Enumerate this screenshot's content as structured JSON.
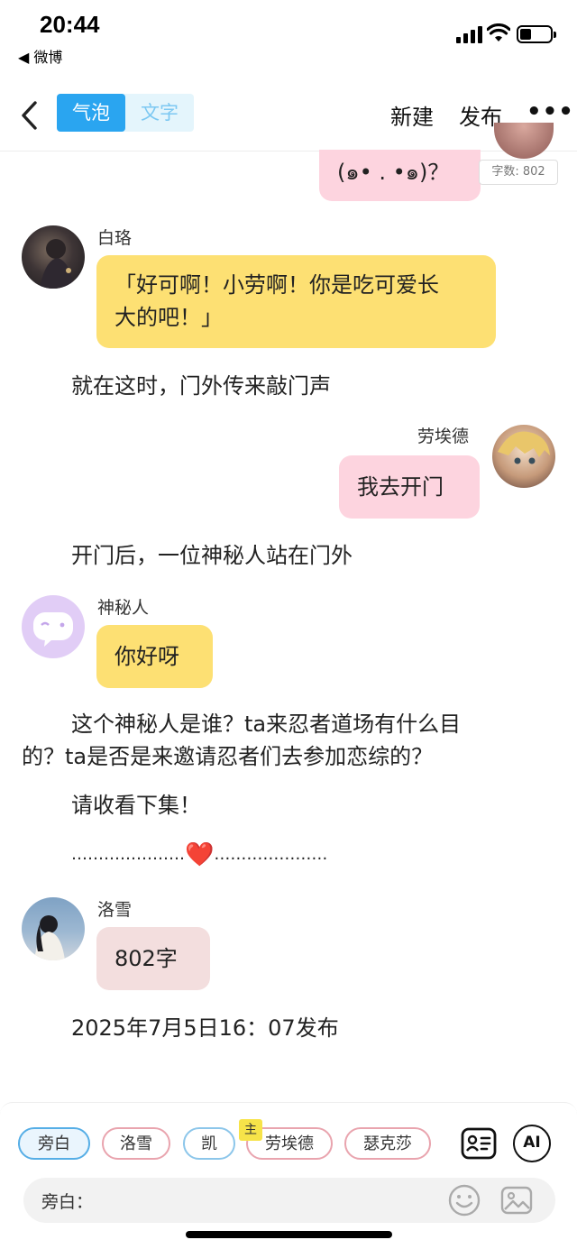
{
  "status": {
    "time": "20:44",
    "back_app": "◀ 微博"
  },
  "nav": {
    "seg_bubble": "气泡",
    "seg_text": "文字",
    "new_label": "新建",
    "publish_label": "发布",
    "more_label": "•••"
  },
  "chat": {
    "partial_bubble": "(๑• . •๑)？",
    "word_count_badge": "字数: 802",
    "msg1_name": "白珞",
    "msg1_text_line1": "「好可啊！小劳啊！你是吃可爱长",
    "msg1_text_line2": "大的吧！」",
    "narr1": "就在这时，门外传来敲门声",
    "msg2_name": "劳埃德",
    "msg2_text": "我去开门",
    "narr2": "开门后，一位神秘人站在门外",
    "msg3_name": "神秘人",
    "msg3_text": "你好呀",
    "narr3_line1": "这个神秘人是谁？ta来忍者道场有什么目",
    "narr3_line2": "的？ta是否是来邀请忍者们去参加恋综的？",
    "narr4": "请收看下集！",
    "divider_left": "…………………",
    "divider_heart": "❤️",
    "divider_right": "…………………",
    "msg4_name": "洛雪",
    "msg4_text": "802字",
    "narr5": "2025年7月5日16：07发布"
  },
  "roles": {
    "chips": [
      "旁白",
      "洛雪",
      "凯",
      "劳埃德",
      "瑟克莎"
    ],
    "lead_badge": "主"
  },
  "input": {
    "label": "旁白："
  },
  "icons": {
    "ai_label": "AI"
  },
  "colors": {
    "accent": "#2aa5f0",
    "yellow_bubble": "#fde073",
    "pink_bubble": "#fdd4df"
  }
}
